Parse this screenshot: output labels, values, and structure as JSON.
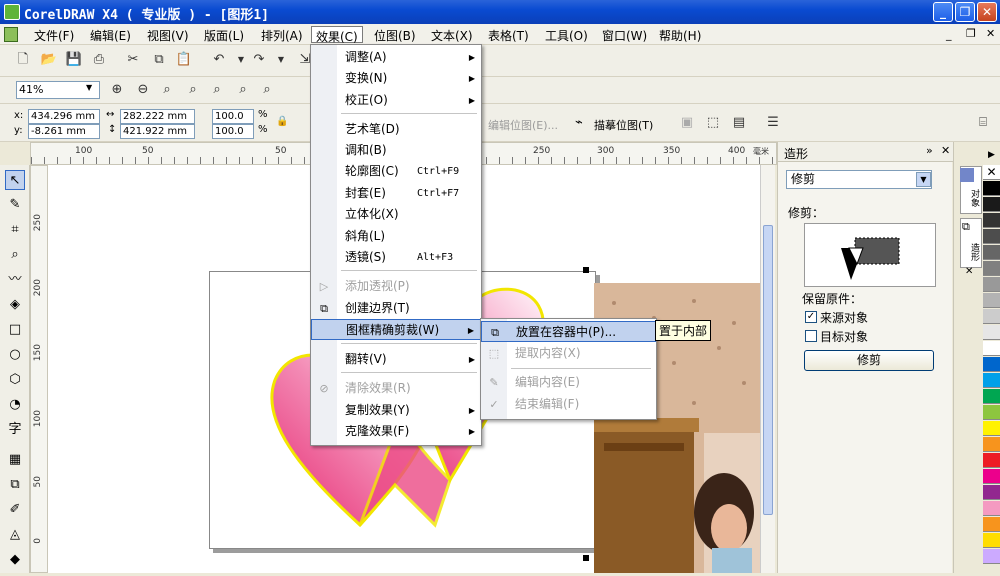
{
  "window": {
    "title": "CorelDRAW X4 ( 专业版 ) - [图形1]"
  },
  "menubar": [
    {
      "label": "文件(F)"
    },
    {
      "label": "编辑(E)"
    },
    {
      "label": "视图(V)"
    },
    {
      "label": "版面(L)"
    },
    {
      "label": "排列(A)"
    },
    {
      "label": "效果(C)"
    },
    {
      "label": "位图(B)"
    },
    {
      "label": "文本(X)"
    },
    {
      "label": "表格(T)"
    },
    {
      "label": "工具(O)"
    },
    {
      "label": "窗口(W)"
    },
    {
      "label": "帮助(H)"
    }
  ],
  "zoom": "41%",
  "property_bar": {
    "x": "434.296 mm",
    "y": "-8.261 mm",
    "width": "282.222 mm",
    "height": "421.922 mm",
    "scale_x": "100.0",
    "scale_y": "100.0",
    "percent": "%",
    "edit_bitmap": "编辑位图(E)...",
    "trace_bitmap": "描摹位图(T)",
    "x_label": "x:",
    "y_label": "y:"
  },
  "ruler": {
    "top_ticks": [
      "100",
      "50",
      "50",
      "250",
      "300",
      "350",
      "400"
    ],
    "unit": "毫米",
    "left_ticks": [
      "250",
      "200",
      "150",
      "100",
      "50",
      "0"
    ]
  },
  "effects_menu": {
    "items": [
      {
        "label": "调整(A)",
        "shortcut": "",
        "submenu": true,
        "disabled": false
      },
      {
        "label": "变换(N)",
        "shortcut": "",
        "submenu": true,
        "disabled": false
      },
      {
        "label": "校正(O)",
        "shortcut": "",
        "submenu": true,
        "disabled": false
      },
      {
        "label": "艺术笔(D)",
        "shortcut": "",
        "submenu": false,
        "disabled": false
      },
      {
        "label": "调和(B)",
        "shortcut": "",
        "submenu": false,
        "disabled": false
      },
      {
        "label": "轮廓图(C)",
        "shortcut": "Ctrl+F9",
        "submenu": false,
        "disabled": false
      },
      {
        "label": "封套(E)",
        "shortcut": "Ctrl+F7",
        "submenu": false,
        "disabled": false
      },
      {
        "label": "立体化(X)",
        "shortcut": "",
        "submenu": false,
        "disabled": false
      },
      {
        "label": "斜角(L)",
        "shortcut": "",
        "submenu": false,
        "disabled": false
      },
      {
        "label": "透镜(S)",
        "shortcut": "Alt+F3",
        "submenu": false,
        "disabled": false
      },
      {
        "label": "添加透视(P)",
        "shortcut": "",
        "submenu": false,
        "disabled": true
      },
      {
        "label": "创建边界(T)",
        "shortcut": "",
        "submenu": false,
        "disabled": false
      },
      {
        "label": "图框精确剪裁(W)",
        "shortcut": "",
        "submenu": true,
        "disabled": false
      },
      {
        "label": "翻转(V)",
        "shortcut": "",
        "submenu": true,
        "disabled": false
      },
      {
        "label": "清除效果(R)",
        "shortcut": "",
        "submenu": false,
        "disabled": true
      },
      {
        "label": "复制效果(Y)",
        "shortcut": "",
        "submenu": true,
        "disabled": false
      },
      {
        "label": "克隆效果(F)",
        "shortcut": "",
        "submenu": true,
        "disabled": false
      }
    ]
  },
  "powerclip_submenu": {
    "items": [
      {
        "label": "放置在容器中(P)...",
        "disabled": false
      },
      {
        "label": "提取内容(X)",
        "disabled": true
      },
      {
        "label": "编辑内容(E)",
        "disabled": true
      },
      {
        "label": "结束编辑(F)",
        "disabled": true
      }
    ]
  },
  "tooltip": "置于内部",
  "docker": {
    "title": "造形",
    "mode": "修剪",
    "section_label": "修剪：",
    "keep_original_label": "保留原件：",
    "source_object": "来源对象",
    "source_checked": true,
    "target_object": "目标对象",
    "target_checked": false,
    "apply_button": "修剪",
    "side_tab_1": "对象",
    "side_tab_2": "造形"
  },
  "colors": {
    "titlebar": "#0a4bd1",
    "highlight": "#c1d2ee",
    "heart_dark": "#e83a7a",
    "heart_light": "#fce6ef",
    "heart_outline": "#f2e600"
  },
  "palette": [
    "#ffffff",
    "#000000",
    "#1a1a1a",
    "#333333",
    "#4d4d4d",
    "#666666",
    "#808080",
    "#999999",
    "#b3b3b3",
    "#cccccc",
    "#e6e6e6",
    "#ffffff",
    "#0066cc",
    "#00a0e9",
    "#00a651",
    "#8dc63f",
    "#fff200",
    "#f7941d",
    "#ed1c24",
    "#ec008c",
    "#92278f",
    "#f49ac1",
    "#f7941d",
    "#ffdd00",
    "#ccaaff"
  ]
}
